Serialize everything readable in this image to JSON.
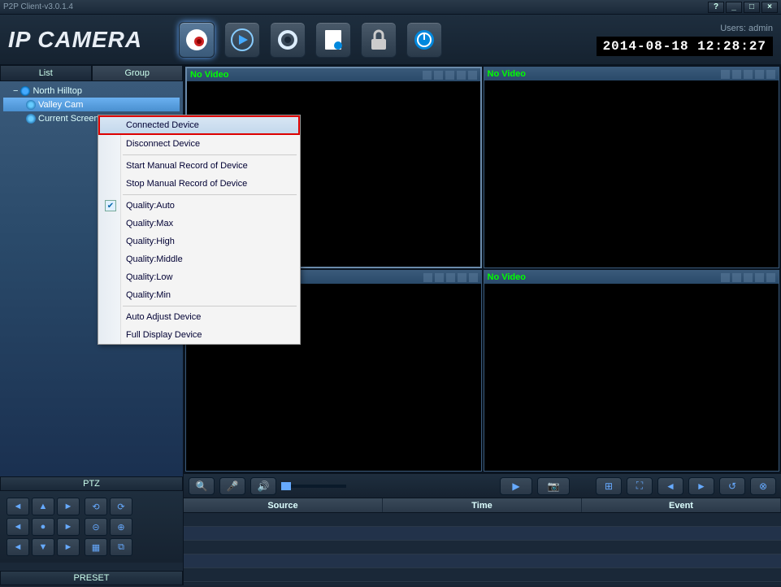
{
  "window": {
    "title": "P2P Client-v3.0.1.4"
  },
  "winctrls": {
    "help": "?",
    "min": "_",
    "max": "□",
    "close": "×"
  },
  "logo": "IP CAMERA",
  "header": {
    "users_label": "Users:",
    "users_value": "admin",
    "datetime": "2014-08-18 12:28:27"
  },
  "toolbar": [
    {
      "name": "live-view",
      "active": true
    },
    {
      "name": "playback",
      "active": false
    },
    {
      "name": "settings",
      "active": false
    },
    {
      "name": "log",
      "active": false
    },
    {
      "name": "lock",
      "active": false
    },
    {
      "name": "power",
      "active": false
    }
  ],
  "sidebar": {
    "tab_list": "List",
    "tab_group": "Group",
    "tree": {
      "root": "North Hilltop",
      "item1": "Valley Cam",
      "item2": "Current Screen"
    },
    "ptz_label": "PTZ",
    "ptz_dirs": [
      "◄",
      "▲",
      "►",
      "◄",
      "●",
      "►",
      "◄",
      "▼",
      "►"
    ],
    "ptz_extra": [
      "⟲",
      "⟳",
      "⊝",
      "⊕",
      "▦",
      "⧉"
    ],
    "preset_label": "PRESET"
  },
  "video": {
    "novideo": "No Video"
  },
  "bottombar": {
    "zoom": "🔍",
    "mic": "🎤",
    "speaker": "🔊",
    "record": "▶",
    "snapshot": "📷",
    "grid4": "⊞",
    "fullscreen": "⛶",
    "prev": "◄",
    "next": "►",
    "loop": "↺",
    "stop": "⊗"
  },
  "events": {
    "col_source": "Source",
    "col_time": "Time",
    "col_event": "Event"
  },
  "contextmenu": {
    "connected": "Connected Device",
    "disconnect": "Disconnect Device",
    "start_rec": "Start Manual Record of Device",
    "stop_rec": "Stop Manual Record of Device",
    "q_auto": "Quality:Auto",
    "q_max": "Quality:Max",
    "q_high": "Quality:High",
    "q_mid": "Quality:Middle",
    "q_low": "Quality:Low",
    "q_min": "Quality:Min",
    "auto_adjust": "Auto Adjust Device",
    "full_display": "Full Display Device"
  }
}
